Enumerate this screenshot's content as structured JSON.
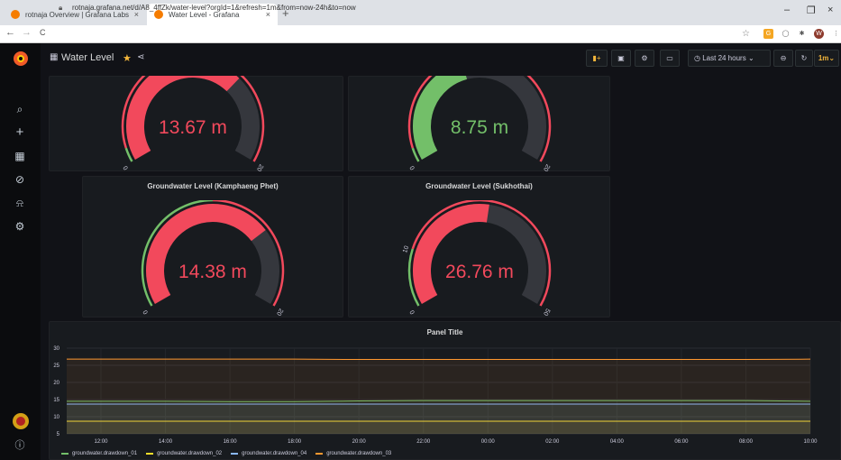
{
  "browser": {
    "tabs": [
      {
        "title": "rotnaja Overview | Grafana Labs",
        "close": "×"
      },
      {
        "title": "Water Level - Grafana",
        "close": "×"
      }
    ],
    "new_tab": "+",
    "window": {
      "minimize": "–",
      "restore": "❐",
      "close": "×"
    },
    "nav": {
      "back": "←",
      "forward": "→",
      "reload": "C"
    },
    "url": "rotnaja.grafana.net/d/A8_4ffZk/water-level?orgId=1&refresh=1m&from=now-24h&to=now",
    "ext_w": "W"
  },
  "dashboard": {
    "title": "Water Level",
    "time_range": "Last 24 hours",
    "refresh": "1m"
  },
  "gauges": [
    {
      "title": "",
      "value": 13.67,
      "display": "13.67 m",
      "min": "0",
      "max": "20",
      "threshold_label": "",
      "color": "#f2495c"
    },
    {
      "title": "",
      "value": 8.75,
      "display": "8.75 m",
      "min": "0",
      "max": "20",
      "threshold_label": "",
      "color": "#73bf69"
    },
    {
      "title": "Groundwater Level (Kamphaeng Phet)",
      "value": 14.38,
      "display": "14.38 m",
      "min": "0",
      "max": "20",
      "threshold_label": "10",
      "color": "#f2495c"
    },
    {
      "title": "Groundwater Level (Sukhothai)",
      "value": 26.76,
      "display": "26.76 m",
      "min": "0",
      "max": "50",
      "threshold_label": "10",
      "color": "#f2495c"
    }
  ],
  "timeseries": {
    "title": "Panel Title",
    "chart_data": {
      "type": "line",
      "x": [
        "12:00",
        "14:00",
        "16:00",
        "18:00",
        "20:00",
        "22:00",
        "00:00",
        "02:00",
        "04:00",
        "06:00",
        "08:00",
        "10:00"
      ],
      "ylim": [
        5,
        30
      ],
      "yticks": [
        "30",
        "25",
        "20",
        "15",
        "10",
        "5"
      ],
      "series": [
        {
          "name": "groundwater.drawdown_01",
          "color": "#73bf69",
          "values": [
            14.5,
            14.5,
            14.4,
            14.4,
            14.6,
            14.7,
            14.7,
            14.7,
            14.7,
            14.7,
            14.7,
            14.5
          ]
        },
        {
          "name": "groundwater.drawdown_02",
          "color": "#fade2a",
          "values": [
            8.7,
            8.7,
            8.7,
            8.7,
            8.7,
            8.7,
            8.7,
            8.7,
            8.7,
            8.7,
            8.7,
            8.7
          ]
        },
        {
          "name": "groundwater.drawdown_04",
          "color": "#8ab8ff",
          "values": [
            13.7,
            13.7,
            13.7,
            13.7,
            13.7,
            13.7,
            13.7,
            13.7,
            13.7,
            13.7,
            13.7,
            13.7
          ]
        },
        {
          "name": "groundwater.drawdown_03",
          "color": "#ff9830",
          "values": [
            26.8,
            26.8,
            26.8,
            26.8,
            26.7,
            26.7,
            26.7,
            26.7,
            26.7,
            26.7,
            26.7,
            26.8
          ]
        }
      ]
    }
  },
  "colors": {
    "red": "#f2495c",
    "green": "#73bf69",
    "track": "#35373d",
    "accent": "#f5b73b"
  }
}
